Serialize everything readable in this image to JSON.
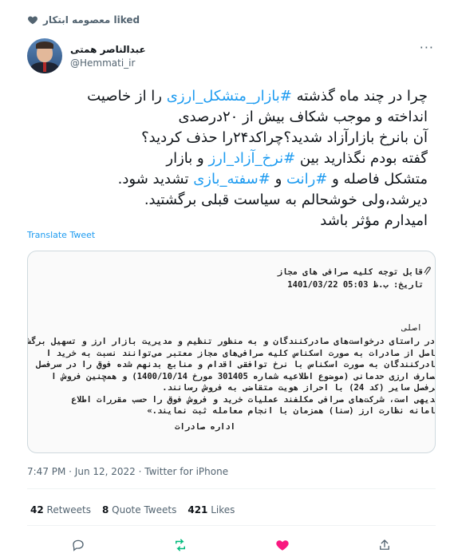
{
  "liked_by": "معصومه ابتکار liked",
  "author": {
    "display_name": "عبدالناصر همتی",
    "handle": "@Hemmati_ir"
  },
  "more_icon": "more-dots-icon",
  "tweet": {
    "lines": [
      [
        "چرا در چند ماه گذشته ",
        {
          "tag": "#بازار_متشکل_ارزی"
        },
        " را از خاصیت"
      ],
      [
        "انداخته و موجب شکاف بیش از ۲۰درصدی"
      ],
      [
        "آن بانرخ بازارآزاد شدید؟چراکد۲۴را حذف کردید؟"
      ],
      [
        "گفته بودم نگذارید بین ",
        {
          "tag": "#نرخ_آزاد_ارز"
        },
        " و بازار"
      ],
      [
        "متشکل فاصله و ",
        {
          "tag": "#رانت"
        },
        " و ",
        {
          "tag": "#سفته_بازی"
        },
        " تشدید شود."
      ],
      [
        "دیرشد،ولی خوشحالم به سیاست قبلی برگشتید."
      ],
      [
        "امیدارم مؤثر باشد"
      ]
    ]
  },
  "translate_label": "Translate Tweet",
  "document": {
    "title": "قابل توجه کلیه صرافی های مجاز",
    "date": "تاریخ: ب.ظ 05:03 1401/03/22",
    "section": "اصلی",
    "body_lines": [
      "«در راستای درخواست‌های صادرکنندگان و به منظور تنظیم و مدیریت بازار ارز و تسهیل برگشت",
      "حاصل از صادرات به صورت اسکناس کلیه صرافی‌های مجاز معتبر می‌توانند نسبت به خرید ا",
      "صادرکنندگان به صورت اسکناس با نرخ توافقی اقدام و منابع بدنهم شده فوق را در سرفصل",
      "مصارف ارزی حدمانی (موضوع اطلاعیه شماره 301405 مورخ 1400/10/14) و همچنین فروش ا",
      "سرفصل سایر (کد 24) با احراز هویت متقاضی به فروش رسانند.",
      "بدیهی است، شرکت‌های صرافی مکلفند عملیات خرید و فروش فوق را حسب مقررات اطلاع",
      "سامانه نظارت ارز (سنا) همزمان با انجام معامله ثبت نمایند.»"
    ],
    "signature": "اداره صادرات"
  },
  "meta": {
    "timestamp": "7:47 PM · Jun 12, 2022 · Twitter for iPhone"
  },
  "stats": {
    "retweets_count": "42",
    "retweets_label": "Retweets",
    "quotes_count": "8",
    "quotes_label": "Quote Tweets",
    "likes_count": "421",
    "likes_label": "Likes"
  },
  "actions": [
    "reply-icon",
    "retweet-icon",
    "like-icon",
    "share-icon"
  ],
  "colors": {
    "accent": "#1d9bf0",
    "like": "#f91880",
    "retweet": "#00ba7c",
    "muted": "#536471"
  }
}
